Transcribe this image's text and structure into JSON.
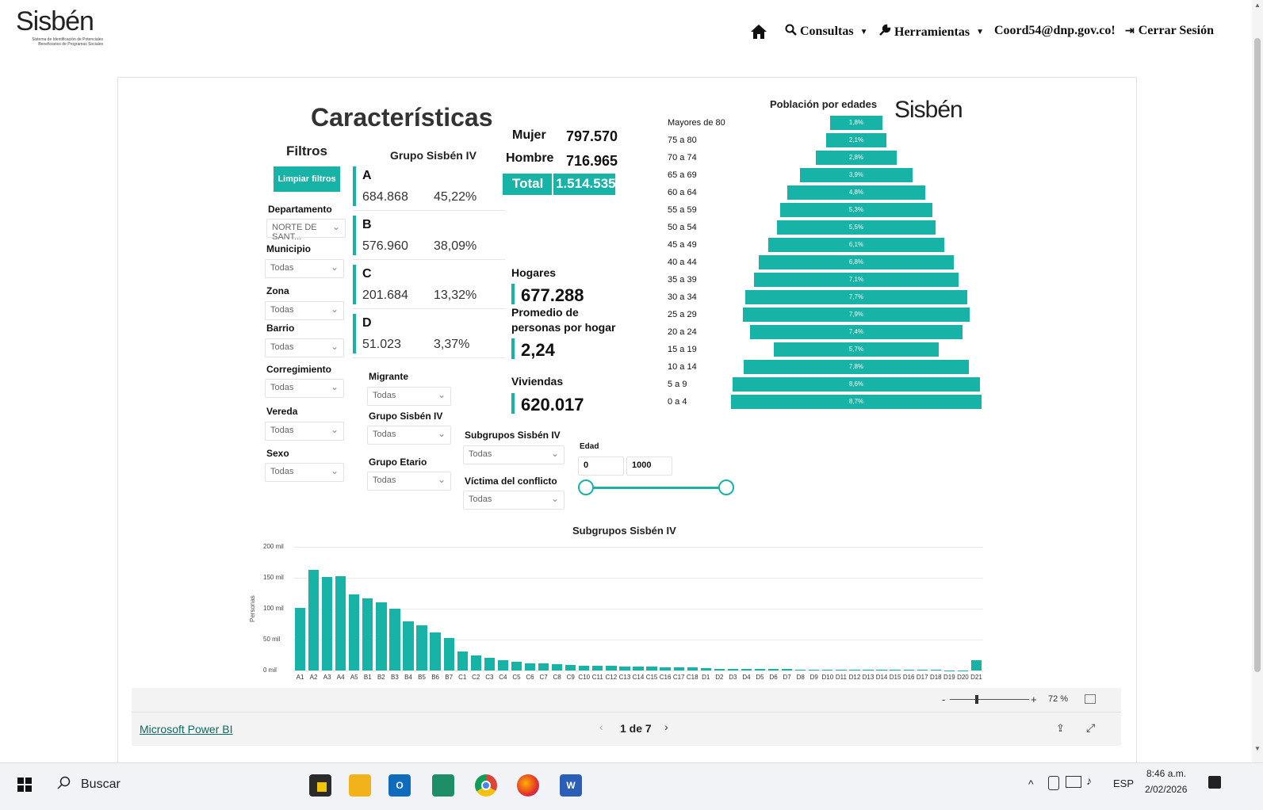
{
  "header": {
    "logo_text": "Sisbén",
    "logo_subtitle": "Sistema de Identificación de Potenciales Beneficiarios de Programas Sociales",
    "nav": {
      "consultas": "Consultas",
      "herramientas": "Herramientas",
      "user": "Coord54@dnp.gov.co!",
      "logout": "Cerrar Sesión"
    }
  },
  "report": {
    "title": "Características",
    "filters": {
      "heading": "Filtros",
      "clear_button": "Limpiar filtros",
      "departamento": {
        "label": "Departamento",
        "value": "NORTE DE SANT..."
      },
      "municipio": {
        "label": "Municipio",
        "value": "Todas"
      },
      "zona": {
        "label": "Zona",
        "value": "Todas"
      },
      "barrio": {
        "label": "Barrio",
        "value": "Todas"
      },
      "corregimiento": {
        "label": "Corregimiento",
        "value": "Todas"
      },
      "vereda": {
        "label": "Vereda",
        "value": "Todas"
      },
      "sexo": {
        "label": "Sexo",
        "value": "Todas"
      },
      "migrante": {
        "label": "Migrante",
        "value": "Todas"
      },
      "grupo_sisben": {
        "label": "Grupo Sisbén IV",
        "value": "Todas"
      },
      "grupo_etario": {
        "label": "Grupo Etario",
        "value": "Todas"
      },
      "subgrupos": {
        "label": "Subgrupos Sisbén IV",
        "value": "Todas"
      },
      "victima": {
        "label": "Víctima del conflicto",
        "value": "Todas"
      },
      "edad": {
        "label": "Edad",
        "min": "0",
        "max": "1000"
      }
    },
    "groups": {
      "heading": "Grupo Sisbén IV",
      "items": [
        {
          "letter": "A",
          "count": "684.868",
          "pct": "45,22%"
        },
        {
          "letter": "B",
          "count": "576.960",
          "pct": "38,09%"
        },
        {
          "letter": "C",
          "count": "201.684",
          "pct": "13,32%"
        },
        {
          "letter": "D",
          "count": "51.023",
          "pct": "3,37%"
        }
      ]
    },
    "totals": {
      "mujer_label": "Mujer",
      "mujer": "797.570",
      "hombre_label": "Hombre",
      "hombre": "716.965",
      "total_label": "Total",
      "total": "1.514.535"
    },
    "hogares": {
      "label": "Hogares",
      "value": "677.288",
      "promedio_label_1": "Promedio de",
      "promedio_label_2": "personas por hogar",
      "promedio": "2,24",
      "viviendas_label": "Viviendas",
      "viviendas": "620.017"
    },
    "pyramid": {
      "title": "Población por edades",
      "rows": [
        {
          "label": "Mayores de 80",
          "pct": 1.8,
          "text": "1,8%"
        },
        {
          "label": "75 a 80",
          "pct": 2.1,
          "text": "2,1%"
        },
        {
          "label": "70 a 74",
          "pct": 2.8,
          "text": "2,8%"
        },
        {
          "label": "65 a 69",
          "pct": 3.9,
          "text": "3,9%"
        },
        {
          "label": "60 a 64",
          "pct": 4.8,
          "text": "4,8%"
        },
        {
          "label": "55 a 59",
          "pct": 5.3,
          "text": "5,3%"
        },
        {
          "label": "50 a 54",
          "pct": 5.5,
          "text": "5,5%"
        },
        {
          "label": "45 a 49",
          "pct": 6.1,
          "text": "6,1%"
        },
        {
          "label": "40 a 44",
          "pct": 6.8,
          "text": "6,8%"
        },
        {
          "label": "35 a 39",
          "pct": 7.1,
          "text": "7,1%"
        },
        {
          "label": "30 a 34",
          "pct": 7.7,
          "text": "7,7%"
        },
        {
          "label": "25 a 29",
          "pct": 7.9,
          "text": "7,9%"
        },
        {
          "label": "20 a 24",
          "pct": 7.4,
          "text": "7,4%"
        },
        {
          "label": "15 a 19",
          "pct": 5.7,
          "text": "5,7%"
        },
        {
          "label": "10 a 14",
          "pct": 7.8,
          "text": "7,8%"
        },
        {
          "label": "5 a 9",
          "pct": 8.6,
          "text": "8,6%"
        },
        {
          "label": "0 a 4",
          "pct": 8.7,
          "text": "8,7%"
        }
      ]
    },
    "chart_data": {
      "type": "bar",
      "title": "Subgrupos Sisbén IV",
      "ylabel": "Personas",
      "ylim": [
        0,
        200000
      ],
      "yticks": [
        "0 mil",
        "50 mil",
        "100 mil",
        "150 mil",
        "200 mil"
      ],
      "categories": [
        "A1",
        "A2",
        "A3",
        "A4",
        "A5",
        "B1",
        "B2",
        "B3",
        "B4",
        "B5",
        "B6",
        "B7",
        "C1",
        "C2",
        "C3",
        "C4",
        "C5",
        "C6",
        "C7",
        "C8",
        "C9",
        "C10",
        "C11",
        "C12",
        "C13",
        "C14",
        "C15",
        "C16",
        "C17",
        "C18",
        "D1",
        "D2",
        "D3",
        "D4",
        "D5",
        "D6",
        "D7",
        "D8",
        "D9",
        "D10",
        "D11",
        "D12",
        "D13",
        "D14",
        "D15",
        "D16",
        "D17",
        "D18",
        "D19",
        "D20",
        "D21"
      ],
      "values": [
        101000,
        163000,
        151000,
        153000,
        123000,
        117000,
        110000,
        100000,
        80000,
        73000,
        62000,
        52000,
        31000,
        25000,
        20000,
        17000,
        14000,
        12000,
        11000,
        10000,
        9000,
        8000,
        8000,
        7500,
        7000,
        6500,
        6000,
        5500,
        5000,
        4500,
        3500,
        3000,
        2800,
        2600,
        2400,
        2200,
        2000,
        1800,
        1600,
        1500,
        1400,
        1300,
        1200,
        1100,
        1000,
        900,
        800,
        700,
        600,
        500,
        17000
      ]
    },
    "footer": {
      "powerbi_link": "Microsoft Power BI",
      "page_indicator": "1 de 7",
      "zoom": "72 %"
    }
  },
  "taskbar": {
    "search": "Buscar",
    "lang": "ESP",
    "time": "8:46 a.m.",
    "date": "2/02/2026"
  }
}
